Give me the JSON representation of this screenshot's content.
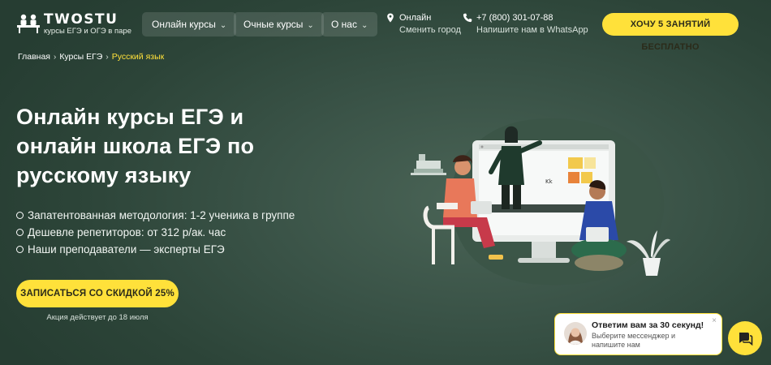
{
  "logo": {
    "title": "TWOSTU",
    "subtitle": "курсы ЕГЭ и ОГЭ в паре"
  },
  "nav": [
    {
      "label": "Онлайн курсы"
    },
    {
      "label": "Очные курсы"
    },
    {
      "label": "О нас"
    }
  ],
  "location": {
    "city": "Онлайн",
    "action": "Сменить город",
    "icon": "location-pin-icon"
  },
  "contact": {
    "phone": "+7 (800) 301-07-88",
    "note": "Напишите нам в WhatsApp",
    "icon": "phone-icon"
  },
  "header_cta": "ХОЧУ 5 ЗАНЯТИЙ БЕСПЛАТНО",
  "breadcrumb": {
    "items": [
      "Главная",
      "Курсы ЕГЭ"
    ],
    "current": "Русский язык",
    "separator": "›"
  },
  "hero": {
    "title": "Онлайн курсы ЕГЭ и онлайн школа ЕГЭ по русскому языку",
    "bullets": [
      "Запатентованная методология: 1-2 ученика в группе",
      "Дешевле репетиторов: от 312 р/ак. час",
      "Наши преподаватели — эксперты ЕГЭ"
    ],
    "cta": "ЗАПИСАТЬСЯ СО СКИДКОЙ 25%",
    "promo_note": "Акция действует до 18 июля"
  },
  "illustration": {
    "board_text": "Kk"
  },
  "chat": {
    "title": "Ответим вам за 30 секунд!",
    "subtitle": "Выберите мессенджер и напишите нам",
    "close": "×"
  },
  "colors": {
    "accent": "#ffe13a",
    "background": "#2f4a3d",
    "nav_button": "rgba(255,255,255,0.12)"
  }
}
